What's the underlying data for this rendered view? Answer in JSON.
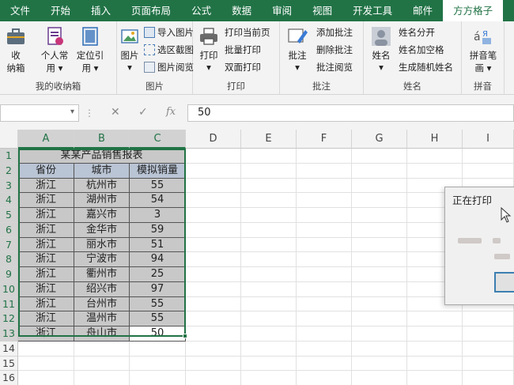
{
  "menu": {
    "tabs": [
      "文件",
      "开始",
      "插入",
      "页面布局",
      "公式",
      "数据",
      "审阅",
      "视图",
      "开发工具",
      "邮件",
      "方方格子"
    ]
  },
  "ribbon": {
    "collection": {
      "btn_line1": "收",
      "btn_line2": "纳箱",
      "group": "我的收纳箱"
    },
    "common": {
      "personal_line1": "个人常",
      "personal_line2": "用",
      "locate_line1": "定位引",
      "locate_line2": "用"
    },
    "picture": {
      "big": "图片",
      "import": "导入图片",
      "crop": "选区截图",
      "browse": "图片阅览",
      "group": "图片"
    },
    "print": {
      "big": "打印",
      "current": "打印当前页",
      "batch": "批量打印",
      "duplex": "双面打印",
      "group": "打印"
    },
    "comment": {
      "big": "批注",
      "add": "添加批注",
      "delete": "删除批注",
      "browse": "批注阅览",
      "group": "批注"
    },
    "name": {
      "big": "姓名",
      "split": "姓名分开",
      "space": "姓名加空格",
      "random": "生成随机姓名",
      "group": "姓名"
    },
    "pinyin": {
      "big_line1": "拼音笔",
      "big_line2": "画",
      "group": "拼音"
    }
  },
  "formula_bar": {
    "name_box": "",
    "fx": "fx",
    "value": "50"
  },
  "grid": {
    "columns": [
      "A",
      "B",
      "C",
      "D",
      "E",
      "F",
      "G",
      "H",
      "I"
    ],
    "rows": [
      "1",
      "2",
      "3",
      "4",
      "5",
      "6",
      "7",
      "8",
      "9",
      "10",
      "11",
      "12",
      "13",
      "14",
      "15",
      "16"
    ],
    "table_title": "某某产品销售报表",
    "headers": [
      "省份",
      "城市",
      "模拟销量"
    ],
    "data": [
      [
        "浙江",
        "杭州市",
        "55"
      ],
      [
        "浙江",
        "湖州市",
        "54"
      ],
      [
        "浙江",
        "嘉兴市",
        "3"
      ],
      [
        "浙江",
        "金华市",
        "59"
      ],
      [
        "浙江",
        "丽水市",
        "51"
      ],
      [
        "浙江",
        "宁波市",
        "94"
      ],
      [
        "浙江",
        "衢州市",
        "25"
      ],
      [
        "浙江",
        "绍兴市",
        "97"
      ],
      [
        "浙江",
        "台州市",
        "55"
      ],
      [
        "浙江",
        "温州市",
        "55"
      ],
      [
        "浙江",
        "舟山市",
        "50"
      ]
    ]
  },
  "dialog": {
    "title": "正在打印"
  },
  "colors": {
    "accent": "#217346",
    "table_fill": "#c8c8c8",
    "header_fill": "#b9c4d4"
  }
}
